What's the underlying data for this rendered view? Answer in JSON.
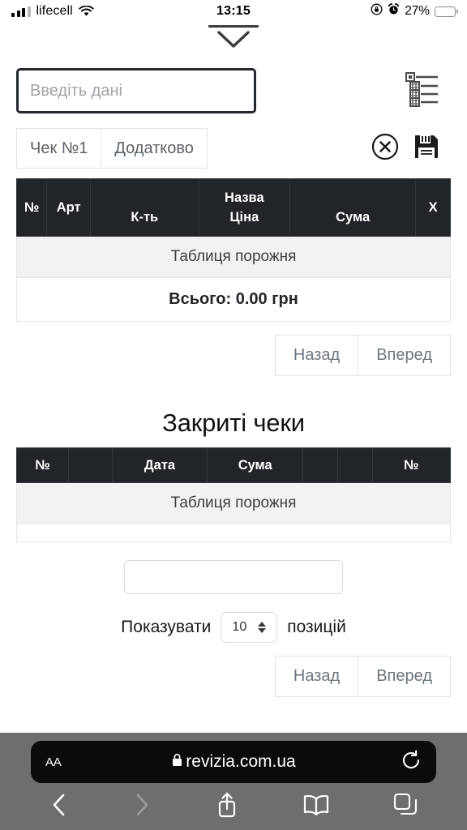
{
  "statusbar": {
    "carrier": "lifecell",
    "time": "13:15",
    "battery_percent": "27%",
    "signal_icon": "cellular-signal-icon",
    "wifi_icon": "wifi-icon",
    "rotation_lock_icon": "rotation-lock-icon",
    "alarm_icon": "alarm-clock-icon",
    "battery_icon": "battery-icon"
  },
  "pulldown": {
    "icon": "chevron-down-icon"
  },
  "receipt": {
    "input_placeholder": "Введіть дані",
    "input_value": "",
    "tree_icon": "tree-structure-icon",
    "tabs": [
      {
        "label": "Чек №1"
      },
      {
        "label": "Додатково"
      }
    ],
    "actions": {
      "close_icon": "close-circle-icon",
      "save_icon": "save-floppy-icon"
    },
    "table": {
      "headers": {
        "num": "№",
        "art": "Арт",
        "qty": "К-ть",
        "name": "Назва",
        "price": "Ціна",
        "sum": "Сума",
        "delete": "X"
      },
      "empty_text": "Таблиця порожня",
      "total_text": "Всього: 0.00 грн"
    },
    "pager": {
      "prev": "Назад",
      "next": "Вперед"
    }
  },
  "closed": {
    "title": "Закриті чеки",
    "table": {
      "headers": {
        "num": "№",
        "blank1": "",
        "date": "Дата",
        "sum": "Сума",
        "blank2": "",
        "blank3": "",
        "num2": "№"
      },
      "empty_text": "Таблиця порожня"
    },
    "search_value": "",
    "show_label_before": "Показувати",
    "show_value": "10",
    "show_label_after": "позицій",
    "pager": {
      "prev": "Назад",
      "next": "Вперед"
    }
  },
  "safari": {
    "text_size_label": "AA",
    "lock_icon": "lock-icon",
    "url": "revizia.com.ua",
    "reload_icon": "reload-icon",
    "back_icon": "back-chevron-icon",
    "forward_icon": "forward-chevron-icon",
    "share_icon": "share-icon",
    "bookmarks_icon": "bookmarks-book-icon",
    "tabs_icon": "tabs-icon"
  },
  "colors": {
    "table_header_bg": "#212529",
    "empty_row_bg": "#f1f2f4",
    "input_border": "#25282c",
    "muted_text": "#6c757d",
    "chrome_bg": "#6e6e6e",
    "urlbar_bg": "#0b0b0b"
  }
}
